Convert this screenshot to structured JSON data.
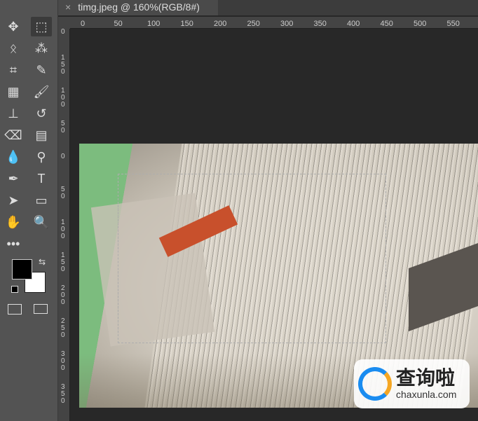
{
  "document_tab": {
    "title": "timg.jpeg @ 160%(RGB/8#)",
    "close_icon": "×"
  },
  "rulers": {
    "horizontal": [
      "0",
      "50",
      "100",
      "150",
      "200",
      "250",
      "300",
      "350",
      "400",
      "450",
      "500",
      "550"
    ],
    "vertical": [
      "0",
      "150",
      "100",
      "50",
      "0",
      "50",
      "100",
      "150",
      "200",
      "250",
      "300",
      "350"
    ]
  },
  "tools": [
    {
      "name": "move-tool",
      "glyph": "✥"
    },
    {
      "name": "marquee-tool",
      "glyph": "⬚"
    },
    {
      "name": "lasso-tool",
      "glyph": "ᛟ"
    },
    {
      "name": "quick-selection-tool",
      "glyph": "⁂"
    },
    {
      "name": "crop-tool",
      "glyph": "⌗"
    },
    {
      "name": "eyedropper-tool",
      "glyph": "✎"
    },
    {
      "name": "healing-brush-tool",
      "glyph": "▦"
    },
    {
      "name": "brush-tool",
      "glyph": "🖌"
    },
    {
      "name": "clone-stamp-tool",
      "glyph": "⊥"
    },
    {
      "name": "history-brush-tool",
      "glyph": "↺"
    },
    {
      "name": "eraser-tool",
      "glyph": "⌫"
    },
    {
      "name": "gradient-tool",
      "glyph": "▤"
    },
    {
      "name": "blur-tool",
      "glyph": "💧"
    },
    {
      "name": "dodge-tool",
      "glyph": "⚲"
    },
    {
      "name": "pen-tool",
      "glyph": "✒"
    },
    {
      "name": "type-tool",
      "glyph": "T"
    },
    {
      "name": "path-selection-tool",
      "glyph": "➤"
    },
    {
      "name": "rectangle-tool",
      "glyph": "▭"
    },
    {
      "name": "hand-tool",
      "glyph": "✋"
    },
    {
      "name": "zoom-tool",
      "glyph": "🔍"
    },
    {
      "name": "more-tools",
      "glyph": "•••"
    }
  ],
  "colors": {
    "foreground": "#000000",
    "background": "#ffffff"
  },
  "watermark": {
    "name": "查询啦",
    "url": "chaxunla.com"
  }
}
